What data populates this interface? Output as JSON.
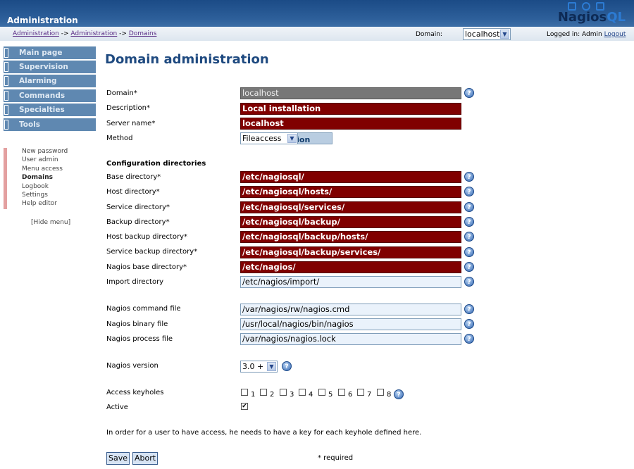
{
  "header": {
    "title": "Administration",
    "logo_text_a": "Nagios",
    "logo_text_b": "QL"
  },
  "breadcrumb": [
    "Administration",
    "Administration",
    "Domains"
  ],
  "breadcrumb_sep": "->",
  "domain_label": "Domain:",
  "domain_value": "localhost",
  "logged_in": "Logged in: Admin",
  "logout": "Logout",
  "nav": [
    "Main page",
    "Supervision",
    "Alarming",
    "Commands",
    "Specialties",
    "Tools",
    "Administration"
  ],
  "sub": [
    "New password",
    "User admin",
    "Menu access",
    "Domains",
    "Logbook",
    "Settings",
    "Help editor"
  ],
  "hide_menu": "[Hide menu]",
  "page_title": "Domain administration",
  "form": {
    "domain": {
      "label": "Domain*",
      "value": "localhost"
    },
    "description": {
      "label": "Description*",
      "value": "Local installation"
    },
    "server": {
      "label": "Server name*",
      "value": "localhost"
    },
    "method": {
      "label": "Method",
      "value": "Fileaccess"
    },
    "section": "Configuration directories",
    "dirs": [
      {
        "label": "Base directory*",
        "value": "/etc/nagiosql/"
      },
      {
        "label": "Host directory*",
        "value": "/etc/nagiosql/hosts/"
      },
      {
        "label": "Service directory*",
        "value": "/etc/nagiosql/services/"
      },
      {
        "label": "Backup directory*",
        "value": "/etc/nagiosql/backup/"
      },
      {
        "label": "Host backup directory*",
        "value": "/etc/nagiosql/backup/hosts/"
      },
      {
        "label": "Service backup directory*",
        "value": "/etc/nagiosql/backup/services/"
      },
      {
        "label": "Nagios base directory*",
        "value": "/etc/nagios/"
      }
    ],
    "import": {
      "label": "Import directory",
      "value": "/etc/nagios/import/"
    },
    "cmdfile": {
      "label": "Nagios command file",
      "value": "/var/nagios/rw/nagios.cmd"
    },
    "binfile": {
      "label": "Nagios binary file",
      "value": "/usr/local/nagios/bin/nagios"
    },
    "procfile": {
      "label": "Nagios process file",
      "value": "/var/nagios/nagios.lock"
    },
    "version": {
      "label": "Nagios version",
      "value": "3.0 +"
    },
    "keyholes": {
      "label": "Access keyholes",
      "items": [
        "1",
        "2",
        "3",
        "4",
        "5",
        "6",
        "7",
        "8"
      ]
    },
    "active": {
      "label": "Active",
      "checked": true
    }
  },
  "note": "In order for a user to have access, he needs to have a key for each keyhole defined here.",
  "save": "Save",
  "abort": "Abort",
  "required": "* required",
  "help_glyph": "?",
  "arrow_glyph": "▼",
  "check_glyph": "✔"
}
